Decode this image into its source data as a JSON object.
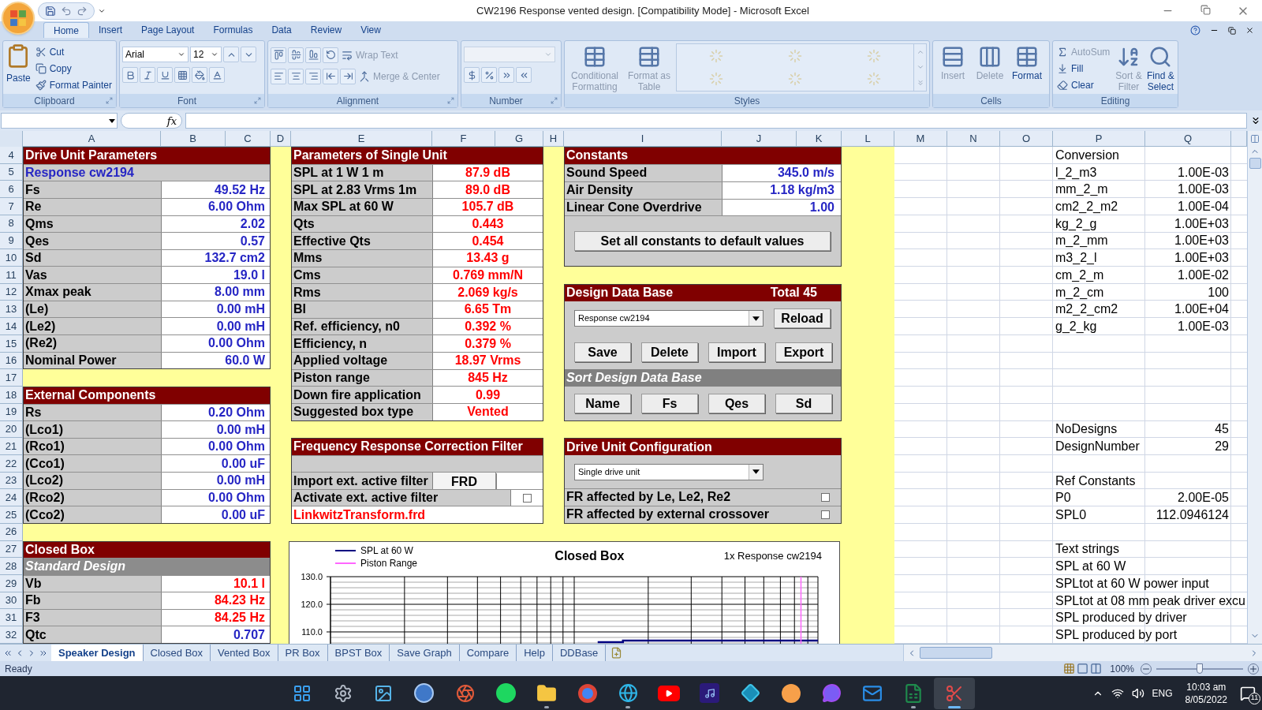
{
  "window": {
    "title": "CW2196 Response vented design.  [Compatibility Mode] - Microsoft Excel"
  },
  "ribbon": {
    "tabs": [
      {
        "label": "Home",
        "selected": true
      },
      {
        "label": "Insert",
        "selected": false
      },
      {
        "label": "Page Layout",
        "selected": false
      },
      {
        "label": "Formulas",
        "selected": false
      },
      {
        "label": "Data",
        "selected": false
      },
      {
        "label": "Review",
        "selected": false
      },
      {
        "label": "View",
        "selected": false
      }
    ],
    "clipboard": {
      "label": "Clipboard",
      "paste": "Paste",
      "cut": "Cut",
      "copy": "Copy",
      "format_painter": "Format Painter"
    },
    "font": {
      "label": "Font",
      "font_name": "Arial",
      "font_size": "12"
    },
    "alignment": {
      "label": "Alignment",
      "buttons": [
        {
          "label": "Wrap Text",
          "disabled": true
        },
        {
          "label": "Merge & Center",
          "disabled": true
        }
      ]
    },
    "number": {
      "label": "Number"
    },
    "styles": {
      "label": "Styles",
      "buttons": [
        {
          "label": "Conditional Formatting",
          "disabled": true
        },
        {
          "label": "Format as Table",
          "disabled": true
        }
      ]
    },
    "cells": {
      "label": "Cells",
      "buttons": [
        {
          "label": "Insert",
          "disabled": true
        },
        {
          "label": "Delete",
          "disabled": true
        },
        {
          "label": "Format",
          "disabled": false
        }
      ]
    },
    "editing": {
      "label": "Editing",
      "small_buttons": [
        {
          "label": "AutoSum",
          "disabled": true
        },
        {
          "label": "Fill",
          "disabled": false
        },
        {
          "label": "Clear",
          "disabled": false
        }
      ],
      "large_buttons": [
        {
          "label": "Sort & Filter",
          "disabled": true
        },
        {
          "label": "Find & Select",
          "disabled": false
        }
      ]
    }
  },
  "formula_bar": {
    "function_label": "fx"
  },
  "columns": [
    "A",
    "B",
    "C",
    "D",
    "E",
    "F",
    "G",
    "H",
    "I",
    "J",
    "K",
    "L",
    "M",
    "N",
    "O",
    "P",
    "Q"
  ],
  "row_numbers": [
    "4",
    "5",
    "6",
    "7",
    "8",
    "9",
    "10",
    "11",
    "12",
    "13",
    "14",
    "15",
    "16",
    "17",
    "18",
    "19",
    "20",
    "21",
    "22",
    "23",
    "24",
    "25",
    "26",
    "27",
    "28",
    "29",
    "30",
    "31",
    "32"
  ],
  "blocks": [
    {
      "header": "Drive Unit Parameters",
      "rows": [
        {
          "kind": "title",
          "label": "Response cw2194"
        },
        {
          "kind": "input",
          "label": "Fs",
          "value": "49.52 Hz"
        },
        {
          "kind": "input",
          "label": "Re",
          "value": "6.00 Ohm"
        },
        {
          "kind": "input",
          "label": "Qms",
          "value": "2.02"
        },
        {
          "kind": "input",
          "label": "Qes",
          "value": "0.57"
        },
        {
          "kind": "input",
          "label": "Sd",
          "value": "132.7 cm2"
        },
        {
          "kind": "input",
          "label": "Vas",
          "value": "19.0 l"
        },
        {
          "kind": "input",
          "label": "Xmax peak",
          "value": "8.00 mm"
        },
        {
          "kind": "input",
          "label": "(Le)",
          "value": "0.00 mH"
        },
        {
          "kind": "input",
          "label": "(Le2)",
          "value": "0.00 mH"
        },
        {
          "kind": "input",
          "label": "(Re2)",
          "value": "0.00 Ohm"
        },
        {
          "kind": "input",
          "label": "Nominal Power",
          "value": "60.0 W"
        }
      ]
    },
    {
      "header": "External Components",
      "rows": [
        {
          "kind": "input",
          "label": "Rs",
          "value": "0.20 Ohm"
        },
        {
          "kind": "input",
          "label": "(Lco1)",
          "value": "0.00 mH"
        },
        {
          "kind": "input",
          "label": "(Rco1)",
          "value": "0.00 Ohm"
        },
        {
          "kind": "input",
          "label": "(Cco1)",
          "value": "0.00 uF"
        },
        {
          "kind": "input",
          "label": "(Lco2)",
          "value": "0.00 mH"
        },
        {
          "kind": "input",
          "label": "(Rco2)",
          "value": "0.00 Ohm"
        },
        {
          "kind": "input",
          "label": "(Cco2)",
          "value": "0.00 uF"
        }
      ]
    },
    {
      "header": "Closed Box",
      "rows": [
        {
          "kind": "subheader",
          "label": "Standard Design"
        },
        {
          "kind": "result",
          "label": "Vb",
          "value": "10.1 l"
        },
        {
          "kind": "result",
          "label": "Fb",
          "value": "84.23 Hz"
        },
        {
          "kind": "result",
          "label": "F3",
          "value": "84.25 Hz"
        },
        {
          "kind": "input",
          "label": "Qtc",
          "value": "0.707"
        }
      ]
    },
    {
      "header": "Parameters of Single Unit",
      "rows": [
        {
          "kind": "result",
          "label": "SPL at 1 W 1 m",
          "value": "87.9 dB"
        },
        {
          "kind": "result",
          "label": "SPL at 2.83 Vrms 1m",
          "value": "89.0 dB"
        },
        {
          "kind": "result",
          "label": "Max SPL at 60 W",
          "value": "105.7 dB"
        },
        {
          "kind": "result",
          "label": "Qts",
          "value": "0.443"
        },
        {
          "kind": "result",
          "label": "Effective Qts",
          "value": "0.454"
        },
        {
          "kind": "result",
          "label": "Mms",
          "value": "13.43 g"
        },
        {
          "kind": "result",
          "label": "Cms",
          "value": "0.769 mm/N"
        },
        {
          "kind": "result",
          "label": "Rms",
          "value": "2.069 kg/s"
        },
        {
          "kind": "result",
          "label": "Bl",
          "value": "6.65 Tm"
        },
        {
          "kind": "result",
          "label": "Ref. efficiency, n0",
          "value": "0.392 %"
        },
        {
          "kind": "result",
          "label": "Efficiency, n",
          "value": "0.379 %"
        },
        {
          "kind": "result",
          "label": "Applied voltage",
          "value": "18.97 Vrms"
        },
        {
          "kind": "result",
          "label": "Piston range",
          "value": "845 Hz"
        },
        {
          "kind": "result",
          "label": "Down fire application",
          "value": "0.99"
        },
        {
          "kind": "result",
          "label": "Suggested box type",
          "value": "Vented"
        }
      ]
    }
  ],
  "filter": {
    "header": "Frequency Response Correction Filter",
    "import_label": "Import ext. active filter",
    "import_button": "FRD",
    "activate_label": "Activate ext. active filter",
    "activate_checked": false,
    "file": "LinkwitzTransform.frd"
  },
  "constants": {
    "header": "Constants",
    "rows": [
      {
        "label": "Sound Speed",
        "value": "345.0 m/s"
      },
      {
        "label": "Air Density",
        "value": "1.18 kg/m3"
      },
      {
        "label": "Linear Cone Overdrive",
        "value": "1.00"
      }
    ],
    "button": "Set all constants to default values"
  },
  "design_db": {
    "header": "Design Data Base",
    "total": "Total 45",
    "dropdown": "Response cw2194",
    "reload": "Reload",
    "buttons": [
      "Save",
      "Delete",
      "Import",
      "Export"
    ],
    "sort_header": "Sort Design Data Base",
    "sort_buttons": [
      "Name",
      "Fs",
      "Qes",
      "Sd"
    ]
  },
  "configuration": {
    "header": "Drive Unit Configuration",
    "dropdown": "Single drive unit",
    "options": [
      {
        "label": "FR affected by Le, Le2, Re2",
        "checked": false
      },
      {
        "label": "FR affected by external crossover",
        "checked": false
      }
    ]
  },
  "chart": {
    "title": "Closed Box",
    "subtitle": "1x Response cw2194",
    "legend": [
      {
        "label": "SPL at 60 W",
        "color": "#000080"
      },
      {
        "label": "Piston Range",
        "color": "#ff66ff"
      }
    ],
    "y_ticks": [
      "130.0",
      "120.0",
      "110.0"
    ]
  },
  "side_groups": [
    {
      "rows": [
        {
          "label": "Conversion"
        },
        {
          "label": "l_2_m3",
          "value": "1.00E-03"
        },
        {
          "label": "mm_2_m",
          "value": "1.00E-03"
        },
        {
          "label": "cm2_2_m2",
          "value": "1.00E-04"
        },
        {
          "label": "kg_2_g",
          "value": "1.00E+03"
        },
        {
          "label": "m_2_mm",
          "value": "1.00E+03"
        },
        {
          "label": "m3_2_l",
          "value": "1.00E+03"
        },
        {
          "label": "cm_2_m",
          "value": "1.00E-02"
        },
        {
          "label": "m_2_cm",
          "value": "100"
        },
        {
          "label": "m2_2_cm2",
          "value": "1.00E+04"
        },
        {
          "label": "g_2_kg",
          "value": "1.00E-03"
        }
      ]
    },
    {
      "rows": [
        {
          "label": "NoDesigns",
          "value": "45"
        },
        {
          "label": "DesignNumber",
          "value": "29"
        }
      ]
    },
    {
      "rows": [
        {
          "label": "Ref Constants"
        },
        {
          "label": "P0",
          "value": "2.00E-05"
        },
        {
          "label": "SPL0",
          "value": "112.0946124"
        }
      ]
    },
    {
      "rows": [
        {
          "label": "Text strings"
        },
        {
          "label": "SPL at 60 W"
        },
        {
          "label": "SPLtot at 60 W power input"
        },
        {
          "label": "SPLtot at 08 mm peak driver excu"
        },
        {
          "label": "SPL produced by driver"
        },
        {
          "label": "SPL produced by port"
        }
      ]
    }
  ],
  "sheet_tabs": [
    {
      "label": "Speaker Design",
      "selected": true
    },
    {
      "label": "Closed Box",
      "selected": false
    },
    {
      "label": "Vented Box",
      "selected": false
    },
    {
      "label": "PR Box",
      "selected": false
    },
    {
      "label": "BPST Box",
      "selected": false
    },
    {
      "label": "Save Graph",
      "selected": false
    },
    {
      "label": "Compare",
      "selected": false
    },
    {
      "label": "Help",
      "selected": false
    },
    {
      "label": "DDBase",
      "selected": false
    }
  ],
  "status_bar": {
    "status": "Ready",
    "zoom": "100%",
    "zoom_slider": {
      "level": 0.5
    }
  },
  "taskbar": {
    "apps": [
      {
        "running": false,
        "selected": false
      },
      {
        "running": false,
        "selected": false
      },
      {
        "running": false,
        "selected": false
      },
      {
        "running": false,
        "selected": false
      },
      {
        "running": false,
        "selected": false
      },
      {
        "running": false,
        "selected": false
      },
      {
        "running": true,
        "selected": false
      },
      {
        "running": false,
        "selected": false
      },
      {
        "running": true,
        "selected": false
      },
      {
        "running": false,
        "selected": false
      },
      {
        "running": false,
        "selected": false
      },
      {
        "running": false,
        "selected": false
      },
      {
        "running": false,
        "selected": false
      },
      {
        "running": false,
        "selected": false
      },
      {
        "running": false,
        "selected": false
      },
      {
        "running": true,
        "selected": false
      },
      {
        "running": true,
        "selected": true
      }
    ],
    "language": "ENG",
    "time": "10:03 am",
    "date": "8/05/2022",
    "notifications": "11"
  }
}
